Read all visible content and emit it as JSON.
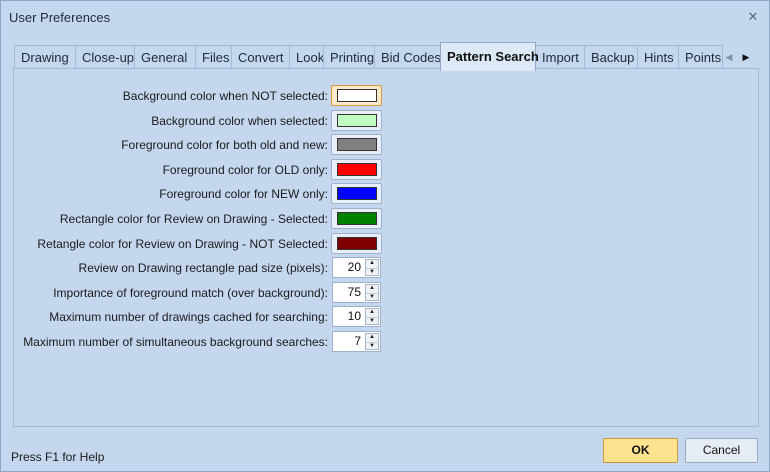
{
  "window": {
    "title": "User Preferences",
    "close_glyph": "✕"
  },
  "tabs": [
    {
      "label": "Drawing",
      "active": false
    },
    {
      "label": "Close-up",
      "active": false
    },
    {
      "label": "General",
      "active": false
    },
    {
      "label": "Files",
      "active": false
    },
    {
      "label": "Convert",
      "active": false
    },
    {
      "label": "Look",
      "active": false
    },
    {
      "label": "Printing",
      "active": false
    },
    {
      "label": "Bid Codes",
      "active": false
    },
    {
      "label": "Pattern Search",
      "active": true
    },
    {
      "label": "Import",
      "active": false
    },
    {
      "label": "Backup",
      "active": false
    },
    {
      "label": "Hints",
      "active": false
    },
    {
      "label": "Points",
      "active": false
    }
  ],
  "tab_nav": {
    "prev_glyph": "◀",
    "next_glyph": "▶",
    "prev_icon": "chevron-left-icon",
    "next_icon": "chevron-right-icon"
  },
  "color_settings": [
    {
      "label": "Background color when NOT selected:",
      "color": "#ffffff",
      "focused": true
    },
    {
      "label": "Background color when selected:",
      "color": "#c0ffc0",
      "focused": false
    },
    {
      "label": "Foreground color for both old and new:",
      "color": "#808080",
      "focused": false
    },
    {
      "label": "Foreground color for OLD only:",
      "color": "#ff0000",
      "focused": false
    },
    {
      "label": "Foreground color for NEW only:",
      "color": "#0000ff",
      "focused": false
    },
    {
      "label": "Rectangle color for Review on Drawing - Selected:",
      "color": "#008000",
      "focused": false
    },
    {
      "label": "Retangle color for Review on Drawing - NOT Selected:",
      "color": "#800000",
      "focused": false
    }
  ],
  "numeric_settings": [
    {
      "label": "Review on Drawing rectangle pad size (pixels):",
      "value": "20"
    },
    {
      "label": "Importance of foreground match (over background):",
      "value": "75"
    },
    {
      "label": "Maximum number of drawings cached for searching:",
      "value": "10"
    },
    {
      "label": "Maximum number of simultaneous background searches:",
      "value": "7"
    }
  ],
  "spin_glyphs": {
    "up": "▲",
    "down": "▼"
  },
  "footer": {
    "help_text": "Press F1 for Help",
    "ok_label": "OK",
    "cancel_label": "Cancel"
  },
  "theme": {
    "window_bg": "#c4d7ee",
    "active_tab_bg": "#dde9f7",
    "ok_bg": "#fde390"
  }
}
